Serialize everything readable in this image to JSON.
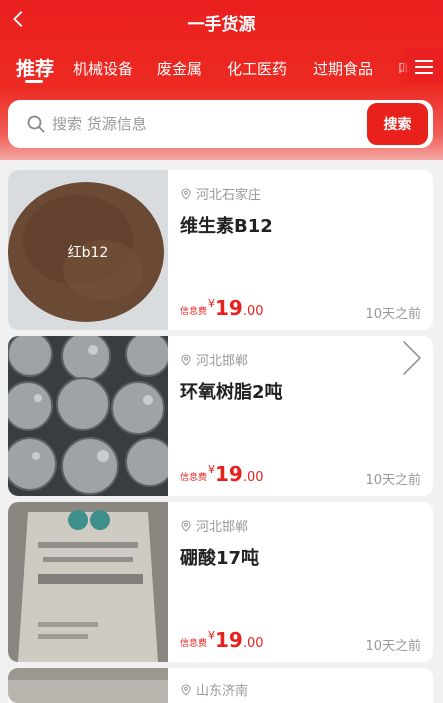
{
  "header": {
    "title": "一手货源",
    "back_icon": "chevron-left-icon"
  },
  "tabs": [
    {
      "label": "推荐",
      "active": true
    },
    {
      "label": "机械设备",
      "active": false
    },
    {
      "label": "废金属",
      "active": false
    },
    {
      "label": "化工医药",
      "active": false
    },
    {
      "label": "过期食品",
      "active": false
    },
    {
      "label": "叫",
      "active": false
    }
  ],
  "menu_icon": "menu-icon",
  "search": {
    "placeholder": "搜索 货源信息",
    "button_label": "搜索"
  },
  "listings": [
    {
      "image_label": "红b12",
      "location": "河北石家庄",
      "name": "维生素B12",
      "price_fee_label": "信息费",
      "currency": "¥",
      "price_int": "19",
      "price_dec": ".00",
      "time": "10天之前"
    },
    {
      "image_label": "",
      "location": "河北邯郸",
      "name": "环氧树脂2吨",
      "price_fee_label": "信息费",
      "currency": "¥",
      "price_int": "19",
      "price_dec": ".00",
      "time": "10天之前"
    },
    {
      "image_label": "",
      "location": "河北邯郸",
      "name": "硼酸17吨",
      "price_fee_label": "信息费",
      "currency": "¥",
      "price_int": "19",
      "price_dec": ".00",
      "time": "10天之前"
    },
    {
      "image_label": "",
      "location": "山东济南",
      "name": "",
      "price_fee_label": "",
      "currency": "",
      "price_int": "",
      "price_dec": "",
      "time": ""
    }
  ],
  "colors": {
    "brand_red": "#e8211c",
    "text_primary": "#222222",
    "text_secondary": "#999999"
  }
}
